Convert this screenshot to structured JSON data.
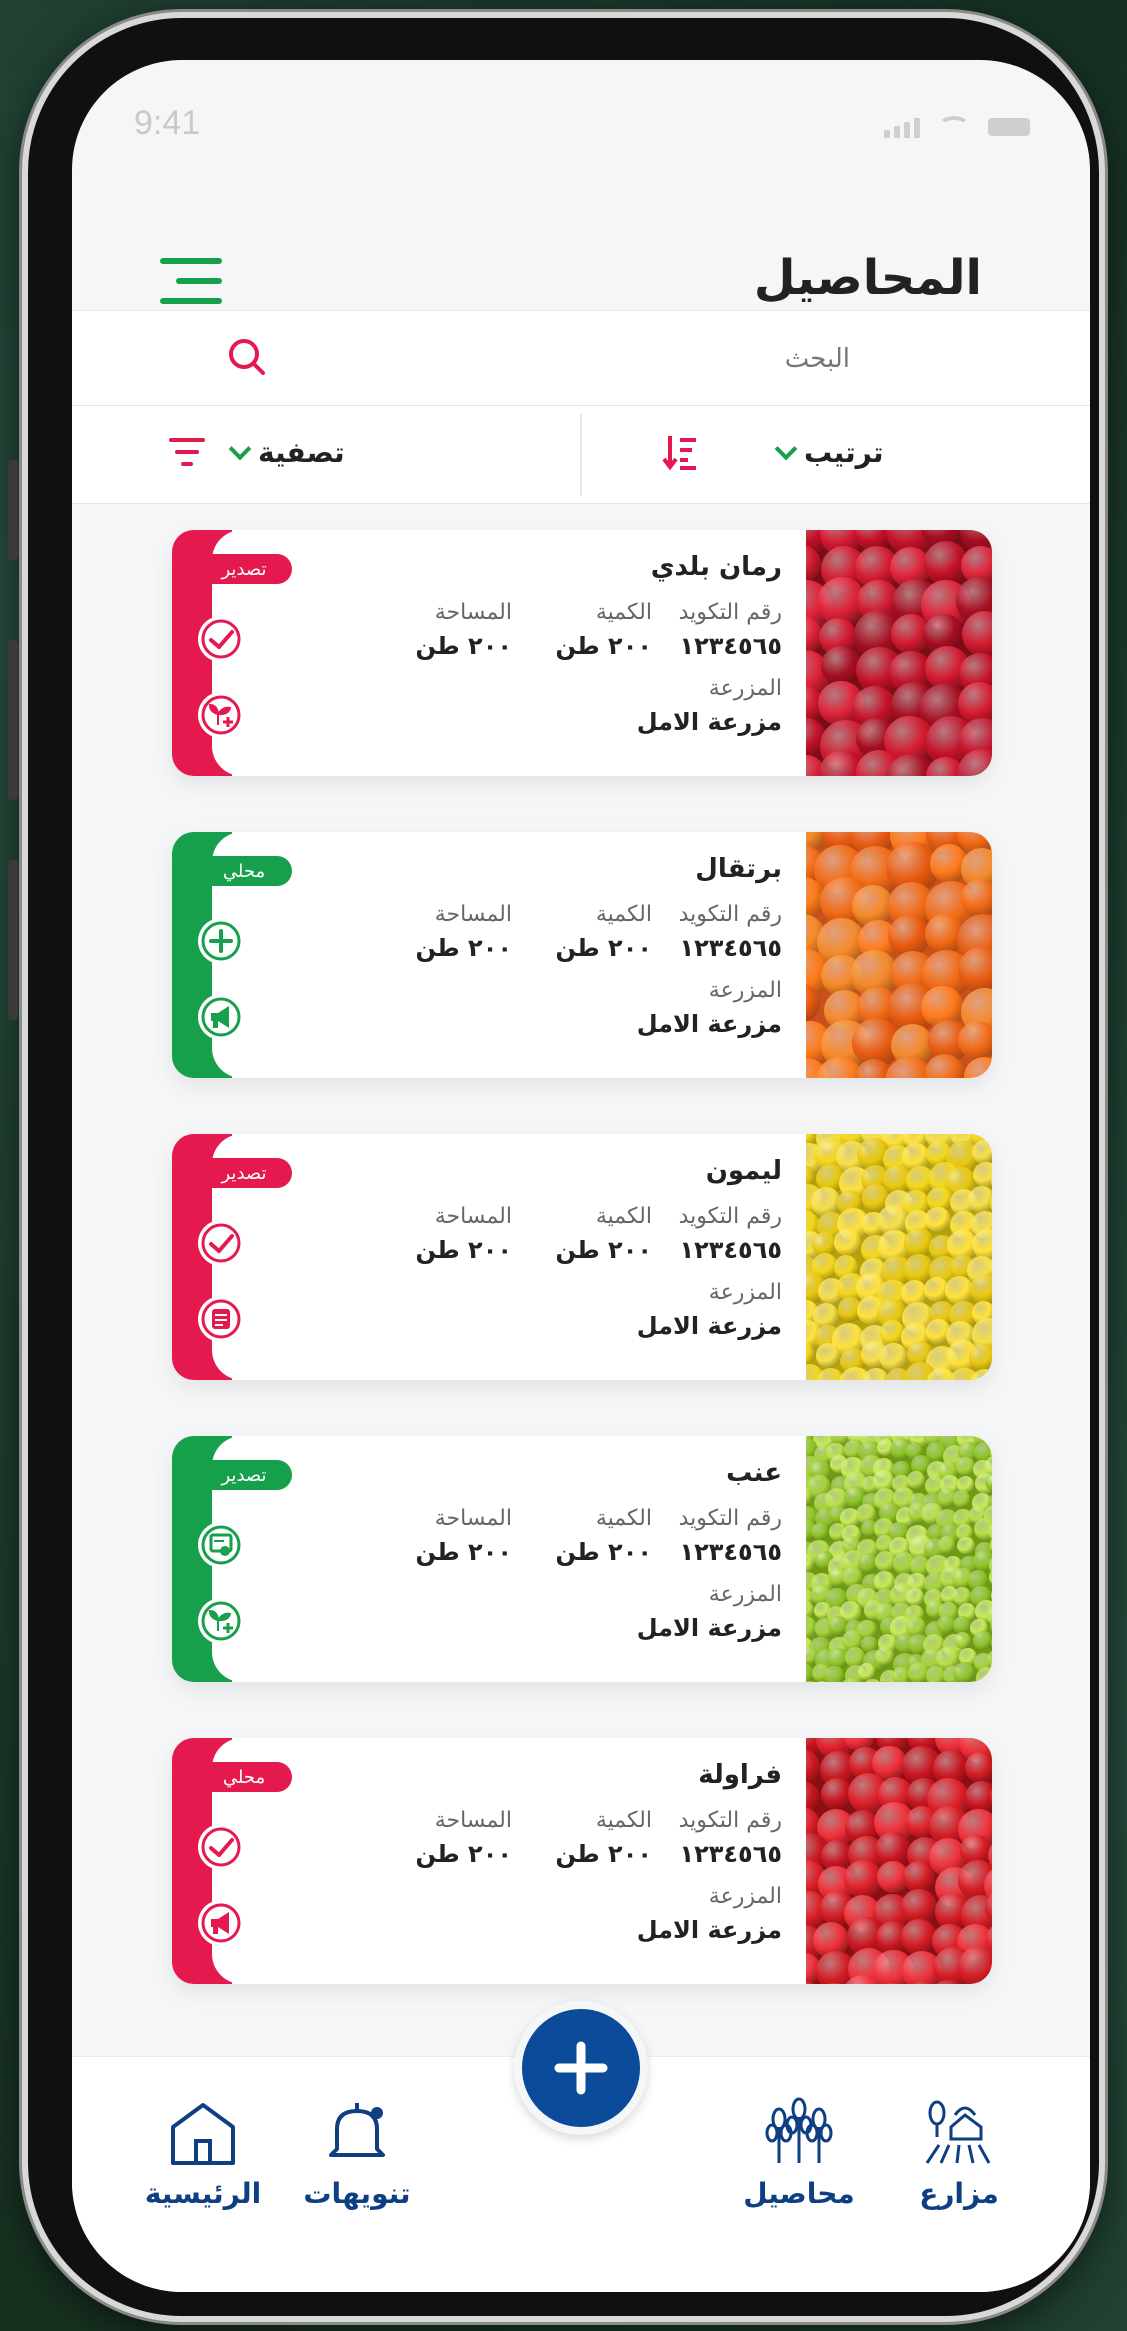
{
  "status_bar": {
    "time": "9:41"
  },
  "header": {
    "title": "المحاصيل"
  },
  "search": {
    "placeholder": "البحث"
  },
  "filters": {
    "sort_label": "ترتيب",
    "filter_label": "تصفية"
  },
  "colors": {
    "green": "#17a04b",
    "red": "#e41a4f",
    "blue": "#0b4b9a",
    "navy": "#0e3f82"
  },
  "labels": {
    "code": "رقم التكويد",
    "quantity": "الكمية",
    "area": "المساحة",
    "farm": "المزرعة"
  },
  "crops": [
    {
      "name": "رمان بلدي",
      "code": "١٢٣٤٥٦٥",
      "quantity": "٢٠٠ طن",
      "area": "٢٠٠ طن",
      "farm": "مزرعة الامل",
      "badge": "تصدير",
      "theme": "red",
      "icon1": "check-icon",
      "icon2": "plant-add-icon",
      "photo": "pomegranate"
    },
    {
      "name": "برتقال",
      "code": "١٢٣٤٥٦٥",
      "quantity": "٢٠٠ طن",
      "area": "٢٠٠ طن",
      "farm": "مزرعة الامل",
      "badge": "محلي",
      "theme": "green",
      "icon1": "plus-icon",
      "icon2": "megaphone-icon",
      "photo": "orange"
    },
    {
      "name": "ليمون",
      "code": "١٢٣٤٥٦٥",
      "quantity": "٢٠٠ طن",
      "area": "٢٠٠ طن",
      "farm": "مزرعة الامل",
      "badge": "تصدير",
      "theme": "red",
      "icon1": "check-icon",
      "icon2": "document-icon",
      "photo": "lemon"
    },
    {
      "name": "عنب",
      "code": "١٢٣٤٥٦٥",
      "quantity": "٢٠٠ طن",
      "area": "٢٠٠ طن",
      "farm": "مزرعة الامل",
      "badge": "تصدير",
      "theme": "green",
      "icon1": "certificate-icon",
      "icon2": "plant-add-icon",
      "photo": "grape"
    },
    {
      "name": "فراولة",
      "code": "١٢٣٤٥٦٥",
      "quantity": "٢٠٠ طن",
      "area": "٢٠٠ طن",
      "farm": "مزرعة الامل",
      "badge": "محلي",
      "theme": "red",
      "icon1": "check-icon",
      "icon2": "megaphone-icon",
      "photo": "strawberry"
    }
  ],
  "nav": {
    "home": "الرئيسية",
    "notifications": "تنويهات",
    "crops": "محاصيل",
    "farms": "مزارع"
  }
}
